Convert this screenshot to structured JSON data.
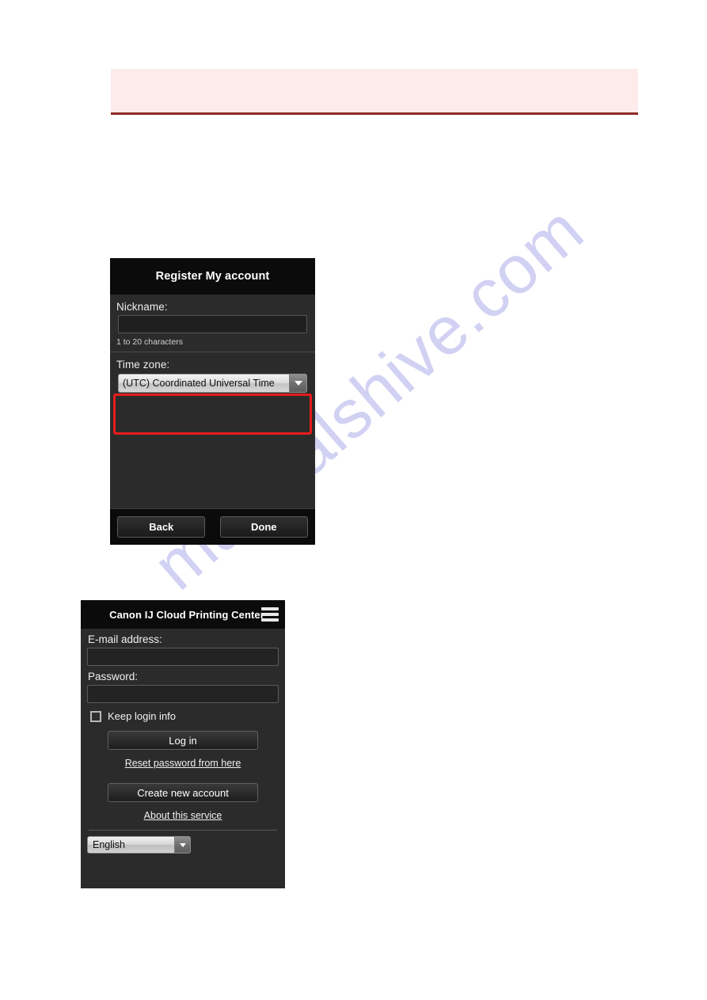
{
  "notice_banner": {
    "text": ""
  },
  "watermark": {
    "text": "manualshive.com"
  },
  "register_panel": {
    "title": "Register My account",
    "nickname": {
      "label": "Nickname:",
      "value": "",
      "hint": "1 to 20 characters"
    },
    "timezone": {
      "label": "Time zone:",
      "selected": "(UTC) Coordinated Universal Time"
    },
    "buttons": {
      "back": "Back",
      "done": "Done"
    },
    "highlight_color": "#e61c1c"
  },
  "login_panel": {
    "title": "Canon IJ Cloud Printing Center",
    "menu_icon": "hamburger-icon",
    "email": {
      "label": "E-mail address:",
      "value": ""
    },
    "password": {
      "label": "Password:",
      "value": ""
    },
    "keep_login": {
      "label": "Keep login info",
      "checked": false
    },
    "login_button": "Log in",
    "reset_password_link": "Reset password from here",
    "create_account_button": "Create new account",
    "about_link": "About this service",
    "language": {
      "selected": "English"
    }
  }
}
